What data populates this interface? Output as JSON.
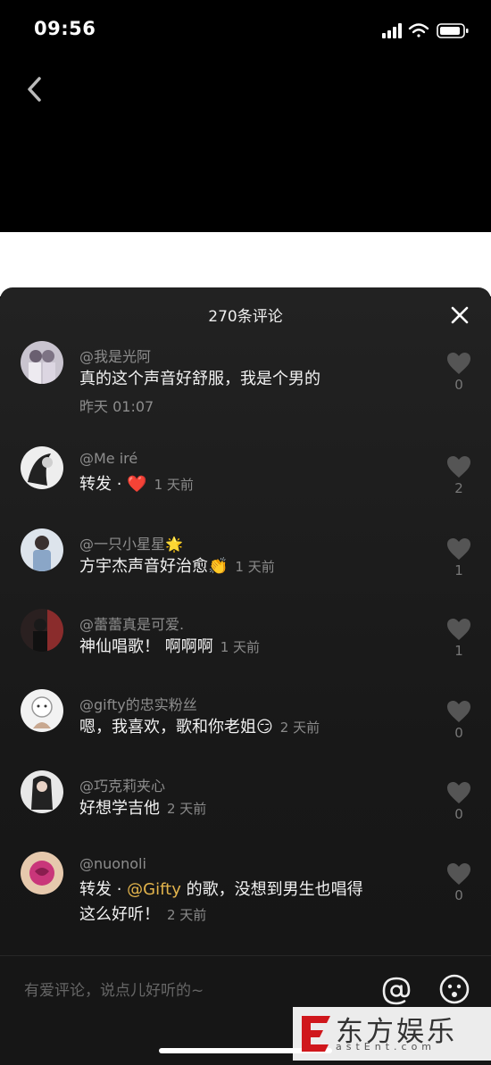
{
  "status_bar": {
    "time": "09:56"
  },
  "sheet": {
    "title": "270条评论"
  },
  "comments": [
    {
      "user": "@我是光阿",
      "text": "真的这个声音好舒服，我是个男的",
      "time": "昨天 01:07",
      "likes": "0"
    },
    {
      "user": "@Me iré",
      "text": "转发 · ",
      "emoji": "❤️",
      "time": "1 天前",
      "likes": "2"
    },
    {
      "user": "@一只小星星",
      "user_emoji": "🌟",
      "text": "方宇杰声音好治愈",
      "emoji": "👏",
      "time": "1 天前",
      "likes": "1"
    },
    {
      "user": "@蕾蕾真是可爱.",
      "text": "神仙唱歌！ 啊啊啊",
      "time": "1 天前",
      "likes": "1"
    },
    {
      "user": "@gifty的忠实粉丝",
      "text": "嗯，我喜欢，歌和你老姐",
      "emoji": "😏",
      "time": "2 天前",
      "likes": "0"
    },
    {
      "user": "@巧克莉夹心",
      "text": "好想学吉他",
      "time": "2 天前",
      "likes": "0"
    },
    {
      "user": "@nuonoli",
      "text_prefix": "转发 · ",
      "mention": "@Gifty",
      "text_line1_rest": " 的歌，没想到男生也唱得",
      "text_line2": "这么好听！",
      "time": "2 天前",
      "likes": "0"
    }
  ],
  "input": {
    "placeholder": "有爱评论，说点儿好听的~"
  },
  "watermark": {
    "cn": "东方娱乐",
    "en": "astEnt.com"
  },
  "colors": {
    "mention": "#e3b44c",
    "heart": "#e8252e"
  }
}
